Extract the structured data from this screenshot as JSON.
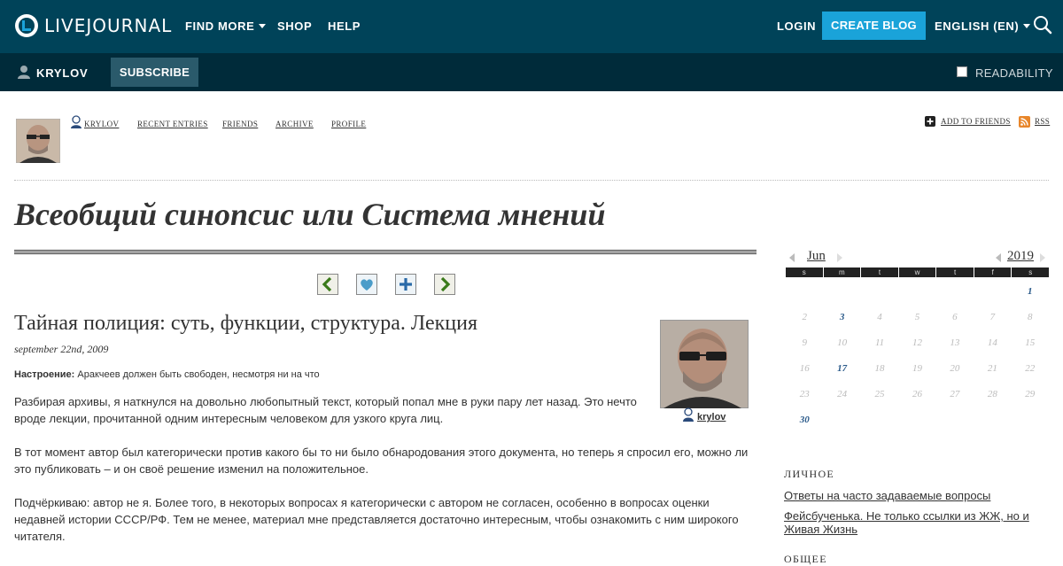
{
  "topbar": {
    "brand": "LIVEJOURNAL",
    "nav": {
      "find_more": "FIND MORE",
      "shop": "SHOP",
      "help": "HELP"
    },
    "login": "LOGIN",
    "create_blog": "CREATE BLOG",
    "language": "ENGLISH (EN)",
    "colors": {
      "bar": "#004359",
      "accent": "#1aa3d9"
    }
  },
  "subbar": {
    "username": "KRYLOV",
    "subscribe": "SUBSCRIBE",
    "readability": "READABILITY",
    "colors": {
      "bar": "#002b3a"
    }
  },
  "journal_nav": {
    "user": "KRYLOV",
    "links": [
      "RECENT ENTRIES",
      "FRIENDS",
      "ARCHIVE",
      "PROFILE"
    ],
    "add_to_friends": "ADD TO FRIENDS",
    "rss": "RSS"
  },
  "journal_title": "Всеобщий синопсис или Система мнений",
  "entry_nav_icons": [
    "prev-entry-icon",
    "memories-icon",
    "add-to-tags-icon",
    "next-entry-icon"
  ],
  "entry": {
    "title": "Тайная полиция: суть, функции, структура. Лекция",
    "date": "september 22nd, 2009",
    "mood_label": "Настроение:",
    "mood_value": "Аракчеев должен быть свободен, несмотря ни на что",
    "poster": "krylov",
    "paragraphs": [
      "Разбирая архивы, я наткнулся на довольно любопытный текст, который попал мне в руки пару лет назад. Это нечто вроде лекции, прочитанной одним интересным человеком для узкого круга лиц.",
      "В тот момент автор был категорически против какого бы то ни было обнародования этого документа, но теперь я спросил его, можно ли это публиковать – и он своё решение изменил на положительное.",
      "Подчёркиваю: автор не я. Более того, в некоторых вопросах я категорически с автором не согласен, особенно в вопросах оценки недавней истории СССР/РФ. Тем не менее, материал мне представляется достаточно интересным, чтобы ознакомить с ним широкого читателя."
    ]
  },
  "calendar": {
    "month": "Jun",
    "year": "2019",
    "weekdays": [
      "s",
      "m",
      "t",
      "w",
      "t",
      "f",
      "s"
    ],
    "weeks": [
      [
        "",
        "",
        "",
        "",
        "",
        "",
        "1"
      ],
      [
        "2",
        "3",
        "4",
        "5",
        "6",
        "7",
        "8"
      ],
      [
        "9",
        "10",
        "11",
        "12",
        "13",
        "14",
        "15"
      ],
      [
        "16",
        "17",
        "18",
        "19",
        "20",
        "21",
        "22"
      ],
      [
        "23",
        "24",
        "25",
        "26",
        "27",
        "28",
        "29"
      ],
      [
        "30",
        "",
        "",
        "",
        "",
        "",
        ""
      ]
    ],
    "active_days": [
      "1",
      "3",
      "17",
      "30"
    ]
  },
  "sidebar": {
    "heading_personal": "ЛИЧНОЕ",
    "personal_links": [
      "Ответы на часто задаваемые вопросы",
      "Фейсбученька. Не только ссылки из ЖЖ, но и Живая Жизнь"
    ],
    "heading_general": "ОБЩЕЕ"
  }
}
